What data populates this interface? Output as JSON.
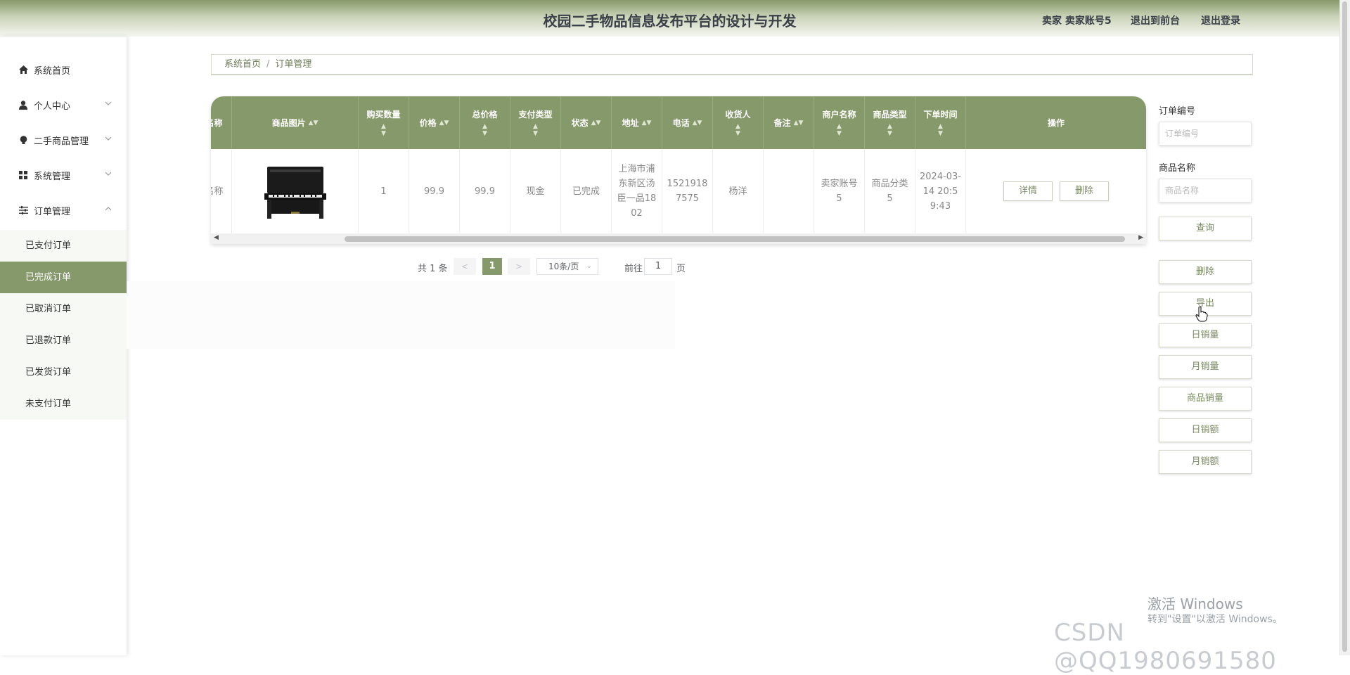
{
  "header": {
    "title": "校园二手物品信息发布平台的设计与开发",
    "user_info": "卖家 卖家账号5",
    "front_link": "退出到前台",
    "logout_link": "退出登录"
  },
  "sidebar": {
    "items": [
      {
        "label": "系统首页",
        "icon": "home-icon"
      },
      {
        "label": "个人中心",
        "icon": "user-icon"
      },
      {
        "label": "二手商品管理",
        "icon": "bulb-icon"
      },
      {
        "label": "系统管理",
        "icon": "grid-icon"
      },
      {
        "label": "订单管理",
        "icon": "sliders-icon"
      }
    ],
    "sub_items": [
      "已支付订单",
      "已完成订单",
      "已取消订单",
      "已退款订单",
      "已发货订单",
      "未支付订单"
    ],
    "active_sub": "已完成订单"
  },
  "breadcrumb": {
    "home": "系统首页",
    "separator": "/",
    "current": "订单管理"
  },
  "table": {
    "headers": [
      "名称",
      "商品图片",
      "购买数量",
      "价格",
      "总价格",
      "支付类型",
      "状态",
      "地址",
      "电话",
      "收货人",
      "备注",
      "商户名称",
      "商品类型",
      "下单时间",
      "操作"
    ],
    "rows": [
      {
        "name_fragment": "名称",
        "quantity": "1",
        "price": "99.9",
        "total": "99.9",
        "pay_type": "现金",
        "status": "已完成",
        "address": "上海市浦东新区汤臣一品1802",
        "phone": "15219187575",
        "receiver": "杨洋",
        "remark": "",
        "merchant": "卖家账号5",
        "category": "商品分类5",
        "order_time": "2024-03-14 20:59:43",
        "detail_btn": "详情",
        "delete_btn": "删除"
      }
    ]
  },
  "pagination": {
    "total": "共 1 条",
    "current_page": "1",
    "page_size": "10条/页",
    "goto_label": "前往",
    "goto_value": "1",
    "page_suffix": "页",
    "prev": "<",
    "next": ">"
  },
  "search_panel": {
    "order_no_label": "订单编号",
    "order_no_placeholder": "订单编号",
    "product_name_label": "商品名称",
    "product_name_placeholder": "商品名称",
    "query_btn": "查询",
    "buttons": [
      "删除",
      "导出",
      "日销量",
      "月销量",
      "商品销量",
      "日销额",
      "月销额"
    ]
  },
  "watermarks": {
    "windows_line1": "激活 Windows",
    "windows_line2": "转到\"设置\"以激活 Windows。",
    "csdn": "CSDN @QQ1980691580"
  },
  "colors": {
    "accent": "#86996a",
    "header_top": "#87996a"
  }
}
